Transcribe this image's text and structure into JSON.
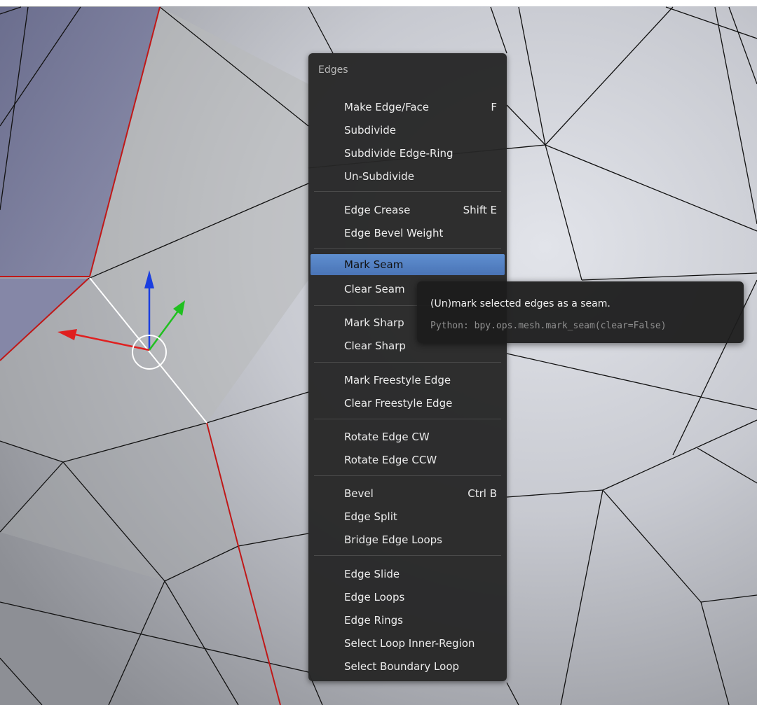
{
  "menu": {
    "title": "Edges",
    "items": [
      {
        "label": "Make Edge/Face",
        "shortcut": "F"
      },
      {
        "label": "Subdivide",
        "shortcut": ""
      },
      {
        "label": "Subdivide Edge-Ring",
        "shortcut": ""
      },
      {
        "label": "Un-Subdivide",
        "shortcut": ""
      },
      {
        "label": "Edge Crease",
        "shortcut": "Shift E"
      },
      {
        "label": "Edge Bevel Weight",
        "shortcut": ""
      },
      {
        "label": "Mark Seam",
        "shortcut": "",
        "highlighted": true
      },
      {
        "label": "Clear Seam",
        "shortcut": ""
      },
      {
        "label": "Mark Sharp",
        "shortcut": ""
      },
      {
        "label": "Clear Sharp",
        "shortcut": ""
      },
      {
        "label": "Mark Freestyle Edge",
        "shortcut": ""
      },
      {
        "label": "Clear Freestyle Edge",
        "shortcut": ""
      },
      {
        "label": "Rotate Edge CW",
        "shortcut": ""
      },
      {
        "label": "Rotate Edge CCW",
        "shortcut": ""
      },
      {
        "label": "Bevel",
        "shortcut": "Ctrl B"
      },
      {
        "label": "Edge Split",
        "shortcut": ""
      },
      {
        "label": "Bridge Edge Loops",
        "shortcut": ""
      },
      {
        "label": "Edge Slide",
        "shortcut": ""
      },
      {
        "label": "Edge Loops",
        "shortcut": ""
      },
      {
        "label": "Edge Rings",
        "shortcut": ""
      },
      {
        "label": "Select Loop Inner-Region",
        "shortcut": ""
      },
      {
        "label": "Select Boundary Loop",
        "shortcut": ""
      }
    ]
  },
  "tooltip": {
    "description": "(Un)mark selected edges as a seam.",
    "python": "Python: bpy.ops.mesh.mark_seam(clear=False)"
  },
  "colors": {
    "highlight": "#5581c4",
    "seam_edge": "#c01818",
    "selected_edge": "#ffffff",
    "gizmo_x": "#e02020",
    "gizmo_y": "#20c020",
    "gizmo_z": "#1a3ee0"
  }
}
